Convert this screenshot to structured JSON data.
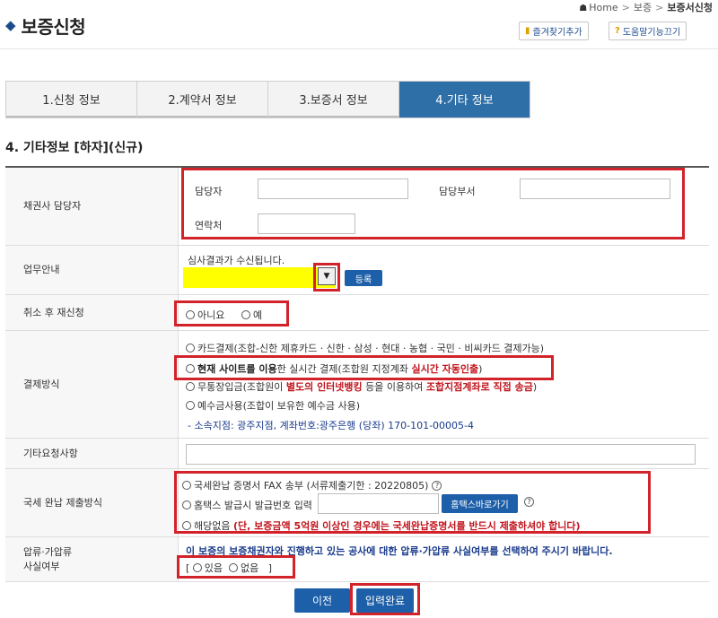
{
  "breadcrumb": {
    "home": "Home",
    "level1": "보증",
    "current": "보증서신청"
  },
  "page": {
    "title": "보증신청"
  },
  "header_buttons": {
    "favorite": "즐겨찾기추가",
    "help": "도움말기능끄기"
  },
  "tabs": [
    {
      "label": "1.신청 정보"
    },
    {
      "label": "2.계약서 정보"
    },
    {
      "label": "3.보증서 정보"
    },
    {
      "label": "4.기타 정보"
    }
  ],
  "section": {
    "title": "4. 기타정보 [하자](신규)"
  },
  "contact": {
    "label": "채권사 담당자",
    "person_label": "담당자",
    "dept_label": "담당부서",
    "phone_label": "연락처"
  },
  "business": {
    "label": "업무안내",
    "notice": "심사결과가 수신됩니다.",
    "register_button": "등록"
  },
  "reapply": {
    "label": "취소 후 재신청",
    "option_no": "아니요",
    "option_yes": "예"
  },
  "payment": {
    "label": "결제방식",
    "card": "카드결제(조합-신한 제휴카드 · 신한 · 삼성 · 현대 · 농협 · 국민 · 비씨카드 결제가능)",
    "site_bold": "현재 사이트를 이용",
    "site_mid": "한 실시간 결제(조합원 지정계좌 ",
    "site_red": "실시간 자동인출",
    "site_end": ")",
    "bank_pre": "무통장입금(조합원이 ",
    "bank_red1": "별도의 인터넷뱅킹",
    "bank_mid": " 등을 이용하여 ",
    "bank_red2": "조합지점계좌로 직접 송금",
    "bank_end": ")",
    "deposit": "예수금사용(조합이 보유한 예수금 사용)",
    "account_info": "- 소속지점: 광주지점, 계좌번호:광주은행 (당좌) 170-101-00005-4"
  },
  "other_request": {
    "label": "기타요청사항"
  },
  "tax": {
    "label": "국세 완납 제출방식",
    "fax": "국세완납 증명서 FAX 송부 (서류제출기한 : 20220805)",
    "hometax": "홈택스 발급시 발급번호 입력",
    "hometax_button": "홈택스바로가기",
    "none_pre": "해당없음 ",
    "none_red": "(단, 보증금액 5억원 이상인 경우에는 국세완납증명서를 반드시 제출하셔야 합니다)"
  },
  "seizure": {
    "label_line1": "압류·가압류",
    "label_line2": "사실여부",
    "notice": "이 보증의 보증채권자와 진행하고 있는 공사에 대한 압류·가압류 사실여부를 선택하여 주시기 바랍니다.",
    "option_yes": "있음",
    "option_no": "없음"
  },
  "buttons": {
    "prev": "이전",
    "complete": "입력완료"
  }
}
